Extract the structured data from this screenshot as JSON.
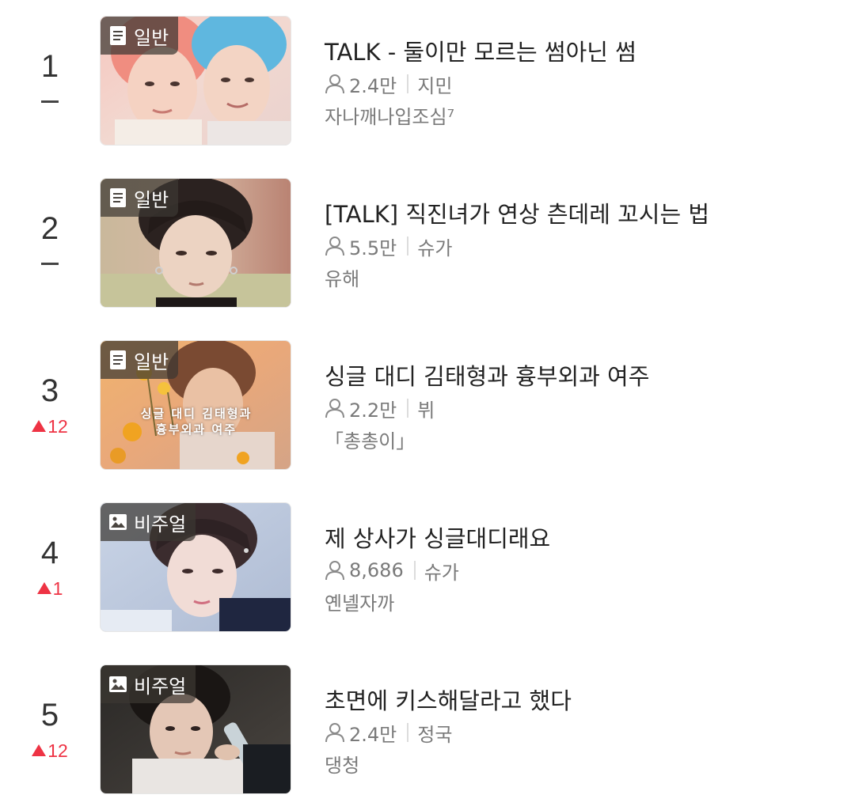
{
  "ranking": {
    "items": [
      {
        "rank": "1",
        "change_type": "same",
        "change_value": "",
        "badge": {
          "label": "일반",
          "icon": "document-icon"
        },
        "thumb_caption": [
          "",
          ""
        ],
        "title": "TALK - 둘이만 모르는 썸아닌 썸",
        "views": "2.4만",
        "character": "지민",
        "author": "자나깨나입조심⁷"
      },
      {
        "rank": "2",
        "change_type": "same",
        "change_value": "",
        "badge": {
          "label": "일반",
          "icon": "document-icon"
        },
        "thumb_caption": [
          "",
          ""
        ],
        "title": "[TALK] 직진녀가 연상 츤데레 꼬시는 법",
        "views": "5.5만",
        "character": "슈가",
        "author": "유해"
      },
      {
        "rank": "3",
        "change_type": "up",
        "change_value": "12",
        "badge": {
          "label": "일반",
          "icon": "document-icon"
        },
        "thumb_caption": [
          "싱글 대디 김태형과",
          "흉부외과 여주"
        ],
        "title": "싱글 대디 김태형과 흉부외과 여주",
        "views": "2.2만",
        "character": "뷔",
        "author": "「총총이」"
      },
      {
        "rank": "4",
        "change_type": "up",
        "change_value": "1",
        "badge": {
          "label": "비주얼",
          "icon": "image-icon"
        },
        "thumb_caption": [
          "",
          ""
        ],
        "title": "제 상사가 싱글대디래요",
        "views": "8,686",
        "character": "슈가",
        "author": "옌녤자까"
      },
      {
        "rank": "5",
        "change_type": "up",
        "change_value": "12",
        "badge": {
          "label": "비주얼",
          "icon": "image-icon"
        },
        "thumb_caption": [
          "",
          ""
        ],
        "title": "초면에 키스해달라고 했다",
        "views": "2.4만",
        "character": "정국",
        "author": "댕청"
      }
    ]
  },
  "colors": {
    "rank_up": "#ee3344",
    "title": "#222222",
    "meta": "#7a7a7a",
    "badge_bg": "rgba(60,55,50,0.72)"
  }
}
